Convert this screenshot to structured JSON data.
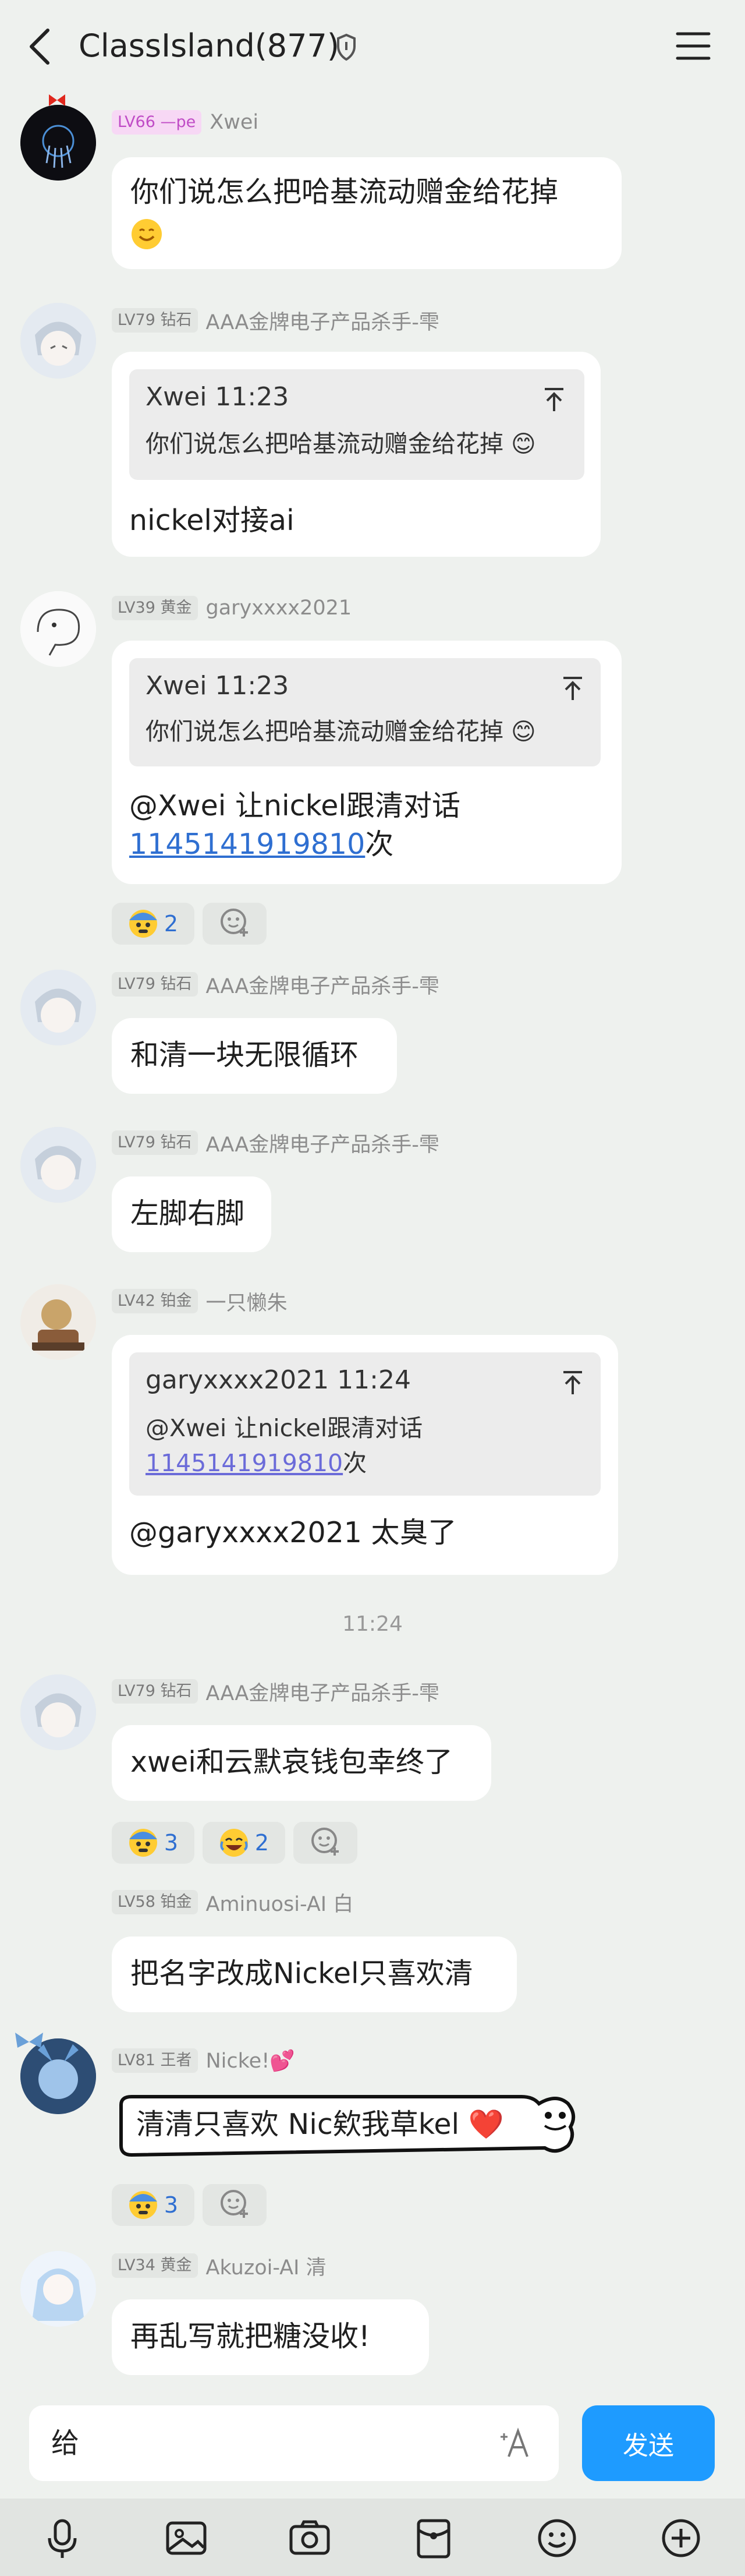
{
  "header": {
    "title": "ClassIsland(877)"
  },
  "messages": [
    {
      "level": "LV66",
      "title": "—pe",
      "name": "Xwei",
      "text": "你们说怎么把哈基流动赠金给花掉"
    },
    {
      "level": "LV79",
      "title": "钻石",
      "name": "AAA金牌电子产品杀手-雫",
      "quote": {
        "head": "Xwei 11:23",
        "body": "你们说怎么把哈基流动赠金给花掉"
      },
      "text": "nickel对接ai"
    },
    {
      "level": "LV39",
      "title": "黄金",
      "name": "garyxxxx2021",
      "quote": {
        "head": "Xwei 11:23",
        "body": "你们说怎么把哈基流动赠金给花掉"
      },
      "text_line1": "@Xwei 让nickel跟清对话",
      "text_link": "1145141919810",
      "text_suffix": "次",
      "reactions": [
        {
          "icon": "fear-emoji",
          "count": "2"
        }
      ]
    },
    {
      "level": "LV79",
      "title": "钻石",
      "name": "AAA金牌电子产品杀手-雫",
      "text": "和清一块无限循环"
    },
    {
      "level": "LV79",
      "title": "钻石",
      "name": "AAA金牌电子产品杀手-雫",
      "text": "左脚右脚"
    },
    {
      "level": "LV42",
      "title": "铂金",
      "name": "一只懒朱",
      "quote": {
        "head": "garyxxxx2021 11:24",
        "body_line1": "@Xwei 让nickel跟清对话",
        "body_link": "1145141919810",
        "body_suffix": "次"
      },
      "text": "@garyxxxx2021 太臭了"
    },
    {
      "level": "LV79",
      "title": "钻石",
      "name": "AAA金牌电子产品杀手-雫",
      "text": "xwei和云默哀钱包幸终了",
      "reactions": [
        {
          "icon": "fear-emoji",
          "count": "3"
        },
        {
          "icon": "laugh-cry-emoji",
          "count": "2"
        }
      ]
    },
    {
      "level": "LV58",
      "title": "铂金",
      "name": "Aminuosi-AI 白",
      "text": "把名字改成Nickel只喜欢清"
    },
    {
      "level": "LV81",
      "title": "王者",
      "name": "Nicke!💕",
      "text": "清清只喜欢 Nic欸我草kel ❤️",
      "reactions": [
        {
          "icon": "fear-emoji",
          "count": "3"
        }
      ]
    },
    {
      "level": "LV34",
      "title": "黄金",
      "name": "Akuzoi-AI 清",
      "text": "再乱写就把糖没收!"
    }
  ],
  "time_separator": "11:24",
  "composer": {
    "value": "给",
    "send_label": "发送"
  },
  "toolbar": [
    "mic-icon",
    "image-icon",
    "camera-icon",
    "red-packet-icon",
    "emoji-icon",
    "plus-icon"
  ],
  "colors": {
    "background": "#eef1ee",
    "send": "#1e9bff",
    "link": "#2f6fd1"
  }
}
